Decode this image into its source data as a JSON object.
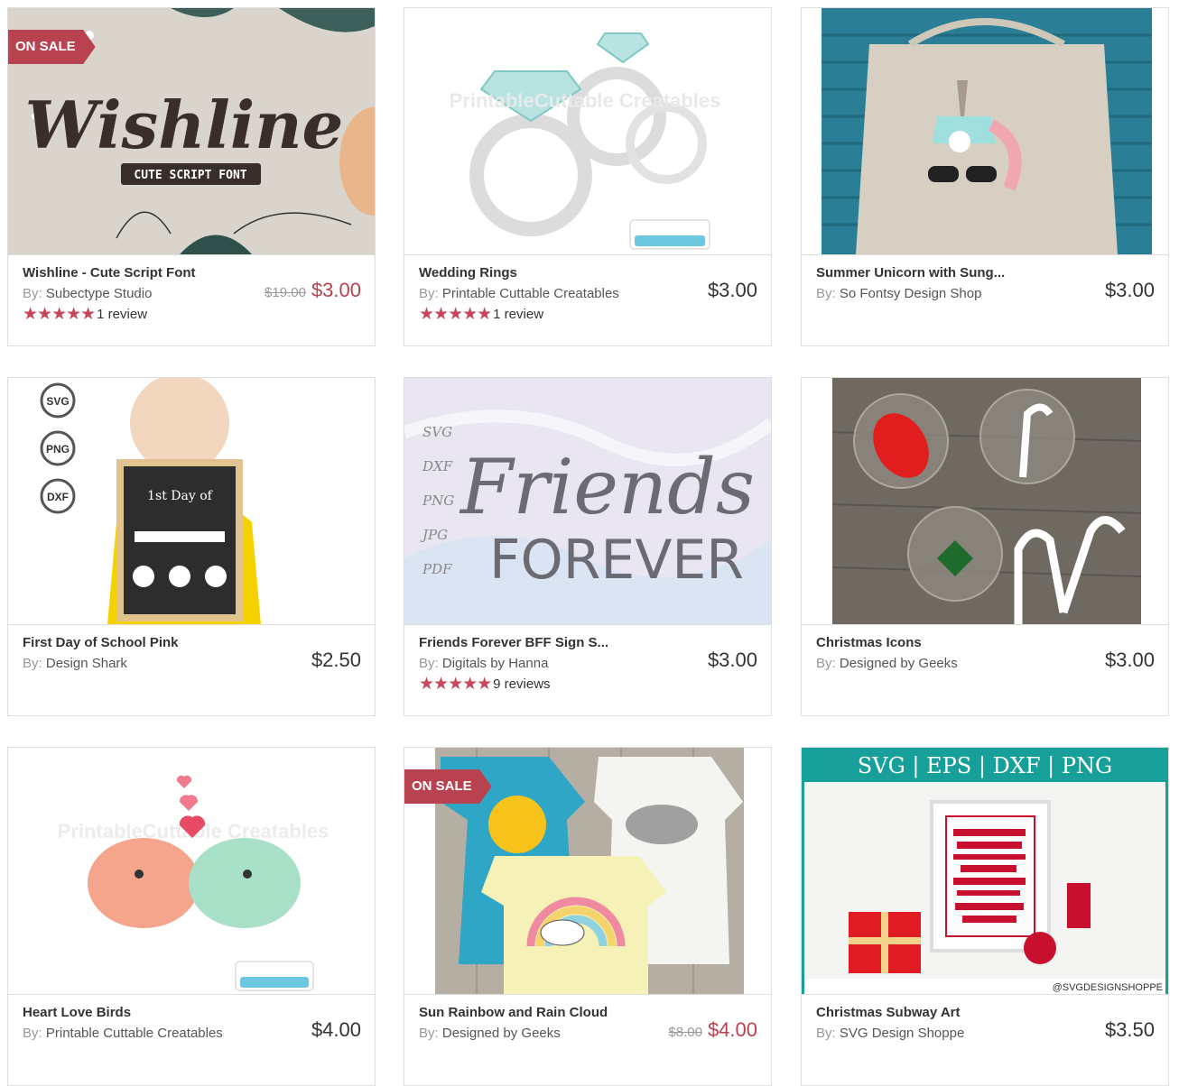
{
  "products": [
    {
      "title": "Wishline - Cute Script Font",
      "by_label": "By:",
      "author": "Subectype Studio",
      "old_price": "$19.00",
      "price": "$3.00",
      "on_sale": true,
      "sale_label": "ON SALE",
      "stars": "★★★★★",
      "reviews": "1 review",
      "image_text": "Wishline",
      "image_subtext": "CUTE SCRIPT FONT"
    },
    {
      "title": "Wedding Rings",
      "by_label": "By:",
      "author": "Printable Cuttable Creatables",
      "price": "$3.00",
      "stars": "★★★★★",
      "reviews": "1 review",
      "image_text": "PrintableCuttable Creatables"
    },
    {
      "title": "Summer Unicorn with Sung...",
      "by_label": "By:",
      "author": "So Fontsy Design Shop",
      "price": "$3.00"
    },
    {
      "title": "First Day of School Pink",
      "by_label": "By:",
      "author": "Design Shark",
      "price": "$2.50",
      "image_badges": [
        "SVG",
        "PNG",
        "DXF"
      ],
      "image_text": "1st Day of"
    },
    {
      "title": "Friends Forever BFF Sign S...",
      "by_label": "By:",
      "author": "Digitals by Hanna",
      "price": "$3.00",
      "stars": "★★★★★",
      "reviews": "9 reviews",
      "image_text": "Friends",
      "image_subtext": "FOREVER",
      "image_formats": [
        "SVG",
        "DXF",
        "PNG",
        "JPG",
        "PDF"
      ]
    },
    {
      "title": "Christmas Icons",
      "by_label": "By:",
      "author": "Designed by Geeks",
      "price": "$3.00"
    },
    {
      "title": "Heart Love Birds",
      "by_label": "By:",
      "author": "Printable Cuttable Creatables",
      "price": "$4.00",
      "image_text": "PrintableCuttable Creatables"
    },
    {
      "title": "Sun Rainbow and Rain Cloud",
      "by_label": "By:",
      "author": "Designed by Geeks",
      "old_price": "$8.00",
      "price": "$4.00",
      "on_sale": true,
      "sale_label": "ON SALE"
    },
    {
      "title": "Christmas Subway Art",
      "by_label": "By:",
      "author": "SVG Design Shoppe",
      "price": "$3.50",
      "image_header": "SVG | EPS | DXF | PNG",
      "image_footer": "@SVGDESIGNSHOPPE"
    }
  ],
  "colors": {
    "sale": "#b8424f",
    "star": "#c9475b",
    "border": "#dedede"
  }
}
